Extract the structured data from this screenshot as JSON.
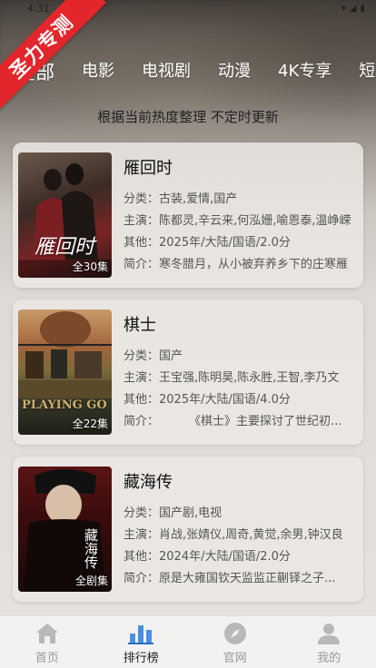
{
  "status_bar": {
    "time": "4:31"
  },
  "ribbon": {
    "text": "圣力专测"
  },
  "tabs": [
    {
      "label": "全部",
      "active": true
    },
    {
      "label": "电影"
    },
    {
      "label": "电视剧"
    },
    {
      "label": "动漫"
    },
    {
      "label": "4K专享"
    },
    {
      "label": "短"
    }
  ],
  "subtitle": "根据当前热度整理 不定时更新",
  "items": [
    {
      "title": "雁回时",
      "badge": "全30集",
      "poster_art": "雁回时",
      "category": "分类：古装,爱情,国产",
      "cast": "主演：陈都灵,辛云来,何泓姗,喻恩泰,温峥嵘",
      "other": "其他：2025年/大陆/国语/2.0分",
      "intro": "简介：寒冬腊月，从小被弃养乡下的庄寒雁"
    },
    {
      "title": "棋士",
      "badge": "全22集",
      "poster_art": "PLAYING GO",
      "category": "分类：国产",
      "cast": "主演：王宝强,陈明昊,陈永胜,王智,李乃文",
      "other": "其他：2025年/大陆/国语/4.0分",
      "intro": "简介：        《棋士》主要探讨了世纪初..."
    },
    {
      "title": "藏海传",
      "badge": "全剧集",
      "poster_art": "藏海传",
      "category": "分类：国产剧,电视",
      "cast": "主演：肖战,张婧仪,周奇,黄觉,余男,钟汉良",
      "other": "其他：2024年/大陆/国语/2.0分",
      "intro": "简介：原是大雍国钦天监监正蒯铎之子..."
    }
  ],
  "bottom_nav": [
    {
      "label": "首页",
      "icon": "home-icon"
    },
    {
      "label": "排行榜",
      "icon": "ranking-icon",
      "active": true
    },
    {
      "label": "官网",
      "icon": "compass-icon"
    },
    {
      "label": "我的",
      "icon": "user-icon"
    }
  ],
  "colors": {
    "ribbon": "#e3262b",
    "nav_active": "#4a90e2"
  }
}
